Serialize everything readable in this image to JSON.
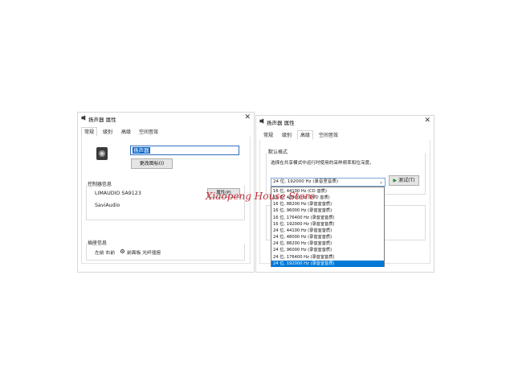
{
  "dialog1": {
    "title": "扬声器 属性",
    "close": "✕",
    "tabs": [
      "常规",
      "级别",
      "高级",
      "空间音效"
    ],
    "name_value": "扬声器",
    "change_icon_label": "更改图标(I)",
    "controller_title": "控制器信息",
    "controller_name": "LIMAUDIO SA9123",
    "controller_vendor": "SaviAudio",
    "properties_label": "属性(P)",
    "jack_title": "插座信息",
    "jack_left": "左前 右前",
    "jack_radio": "前面板 光纤插座"
  },
  "dialog2": {
    "title": "扬声器 属性",
    "close": "✕",
    "tabs": [
      "常规",
      "级别",
      "高级",
      "空间音效"
    ],
    "section_title": "默认格式",
    "description": "选择在共享模式中运行时使用的采样频率和位深度。",
    "selected_format": "24 位, 192000 Hz (录音室音质)",
    "test_label": "测试(T)",
    "dropdown_options": [
      "16 位, 44100 Hz (CD 音质)",
      "16 位, 48000 Hz (DVD 音质)",
      "16 位, 88200 Hz (录音室音质)",
      "16 位, 96000 Hz (录音室音质)",
      "16 位, 176400 Hz (录音室音质)",
      "16 位, 192000 Hz (录音室音质)",
      "24 位, 44100 Hz (录音室音质)",
      "24 位, 48000 Hz (录音室音质)",
      "24 位, 88200 Hz (录音室音质)",
      "24 位, 96000 Hz (录音室音质)",
      "24 位, 176400 Hz (录音室音质)",
      "24 位, 192000 Hz (录音室音质)"
    ],
    "selected_index": 11
  },
  "watermark": "Xiaopeng House Store",
  "icons": {
    "speaker": "speaker-icon",
    "close": "close-icon",
    "chevron": "chevron-down-icon",
    "play": "play-icon"
  }
}
